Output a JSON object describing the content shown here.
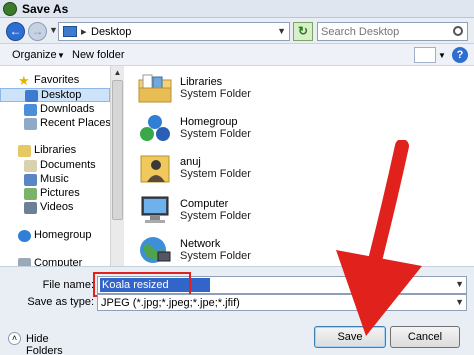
{
  "window": {
    "title": "Save As"
  },
  "address_bar": {
    "path": "Desktop",
    "search_placeholder": "Search Desktop"
  },
  "toolbar": {
    "organize_label": "Organize",
    "new_folder_label": "New folder"
  },
  "nav_pane": {
    "items": [
      {
        "label": "Favorites",
        "icon": "star-icon",
        "level": 0
      },
      {
        "label": "Desktop",
        "icon": "desktop-icon",
        "level": 1,
        "selected": true
      },
      {
        "label": "Downloads",
        "icon": "downloads-icon",
        "level": 1
      },
      {
        "label": "Recent Places",
        "icon": "recent-places-icon",
        "level": 1
      },
      {
        "label": "Libraries",
        "icon": "libraries-icon",
        "level": 0
      },
      {
        "label": "Documents",
        "icon": "documents-icon",
        "level": 1
      },
      {
        "label": "Music",
        "icon": "music-icon",
        "level": 1
      },
      {
        "label": "Pictures",
        "icon": "pictures-icon",
        "level": 1
      },
      {
        "label": "Videos",
        "icon": "videos-icon",
        "level": 1
      },
      {
        "label": "Homegroup",
        "icon": "homegroup-icon",
        "level": 0
      },
      {
        "label": "Computer",
        "icon": "computer-icon",
        "level": 0
      }
    ]
  },
  "files": [
    {
      "name": "Libraries",
      "type": "System Folder",
      "icon": "libraries-folder-icon"
    },
    {
      "name": "Homegroup",
      "type": "System Folder",
      "icon": "homegroup-icon"
    },
    {
      "name": "anuj",
      "type": "System Folder",
      "icon": "user-folder-icon"
    },
    {
      "name": "Computer",
      "type": "System Folder",
      "icon": "computer-icon"
    },
    {
      "name": "Network",
      "type": "System Folder",
      "icon": "network-icon"
    }
  ],
  "save_form": {
    "file_name_label": "File name:",
    "file_name_value": "Koala resized",
    "save_as_type_label": "Save as type:",
    "save_as_type_value": "JPEG (*.jpg;*.jpeg;*.jpe;*.jfif)"
  },
  "footer": {
    "hide_folders_label": "Hide Folders",
    "save_label": "Save",
    "cancel_label": "Cancel"
  },
  "colors": {
    "annotation_red": "#e0211c",
    "selection_blue": "#3165c9"
  }
}
